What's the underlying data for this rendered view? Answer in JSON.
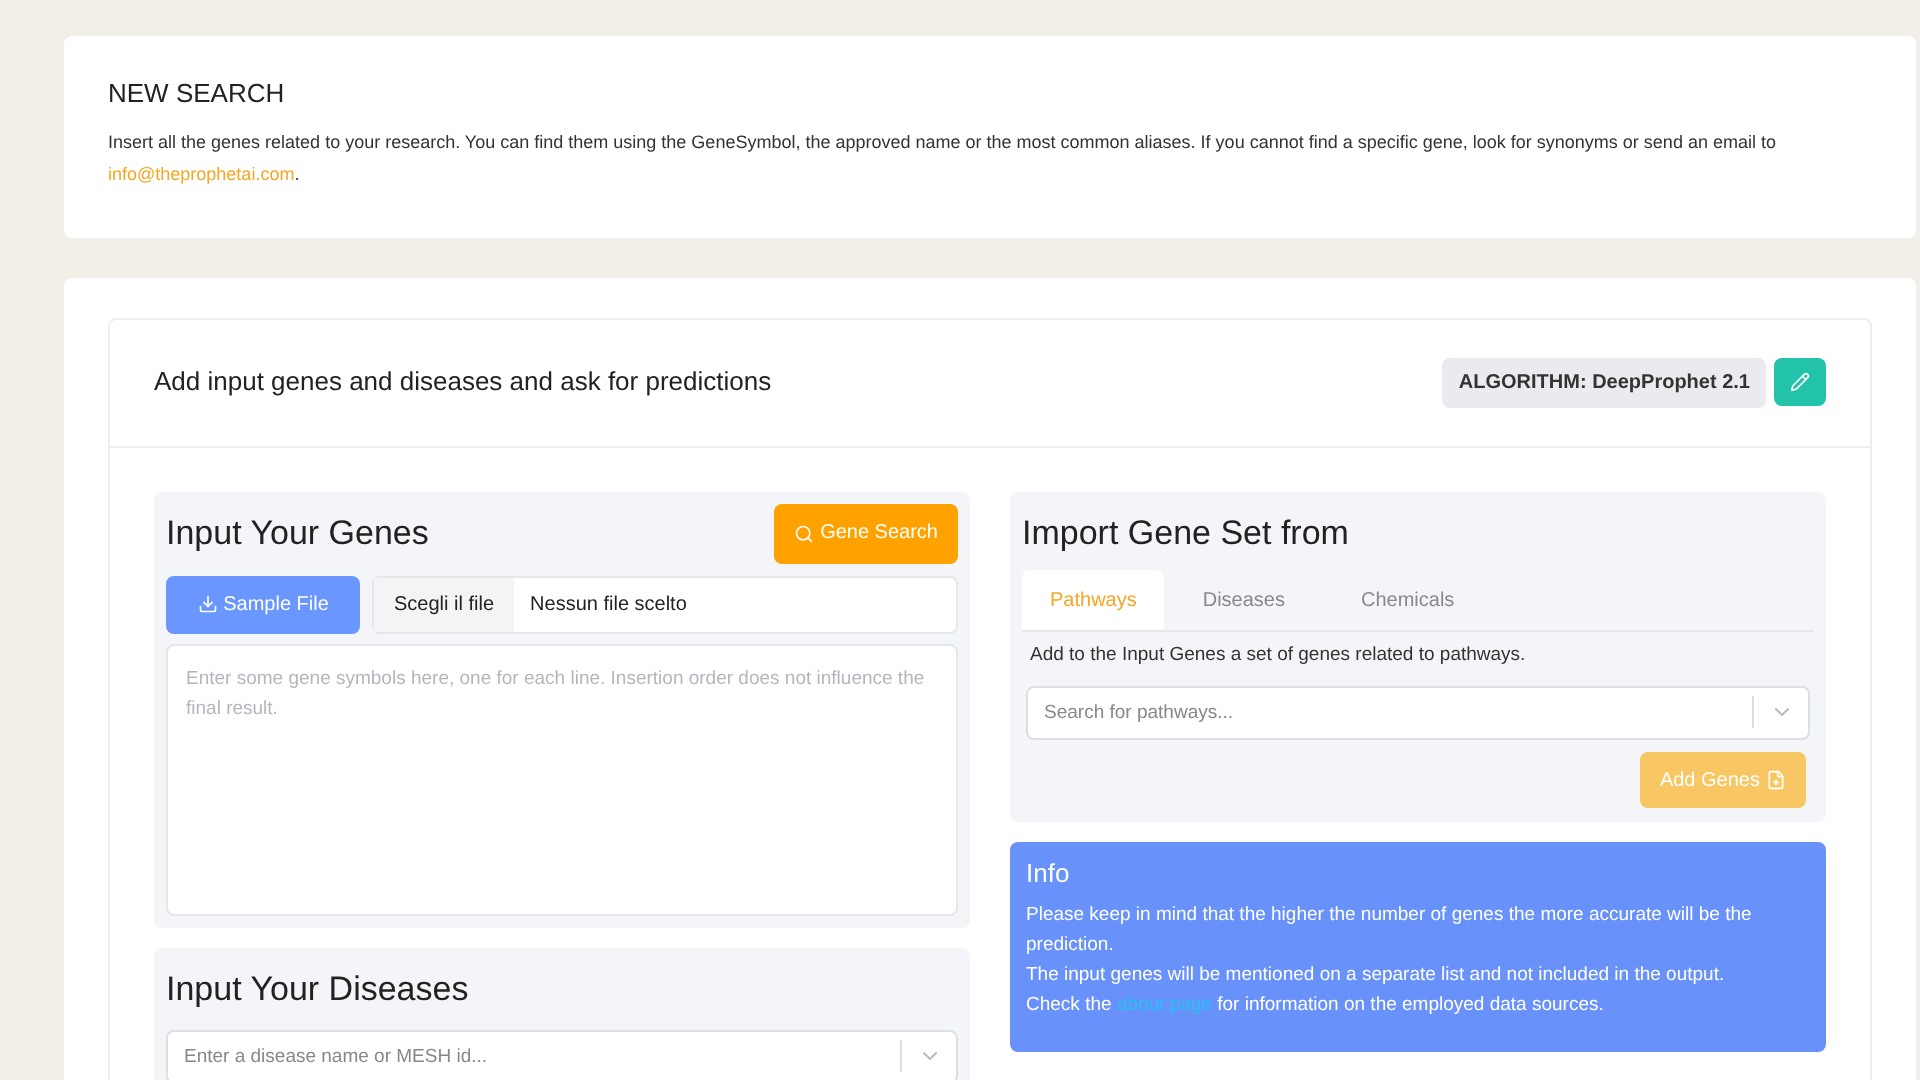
{
  "intro": {
    "title": "NEW SEARCH",
    "text_before": "Insert all the genes related to your research. You can find them using the GeneSymbol, the approved name or the most common aliases. If you cannot find a specific gene, look for synonyms or send an email to ",
    "email": "info@theprophetai.com",
    "text_after": "."
  },
  "card": {
    "title": "Add input genes and diseases and ask for predictions",
    "algorithm": "ALGORITHM: DeepProphet 2.1"
  },
  "genes": {
    "title": "Input Your Genes",
    "search_button": "Gene Search",
    "sample_button": "Sample File",
    "file_button": "Scegli il file",
    "file_status": "Nessun file scelto",
    "placeholder": "Enter some gene symbols here, one for each line. Insertion order does not influence the final result."
  },
  "diseases": {
    "title": "Input Your Diseases",
    "placeholder": "Enter a disease name or MESH id..."
  },
  "import": {
    "title": "Import Gene Set from",
    "tabs": [
      {
        "label": "Pathways",
        "selected": true
      },
      {
        "label": "Diseases",
        "selected": false
      },
      {
        "label": "Chemicals",
        "selected": false
      }
    ],
    "description": "Add to the Input Genes a set of genes related to pathways.",
    "placeholder": "Search for pathways...",
    "add_button": "Add Genes",
    "add_disabled": true
  },
  "info": {
    "title": "Info",
    "line1": "Please keep in mind that the higher the number of genes the more accurate will be the prediction.",
    "line2": "The input genes will be mentioned on a separate list and not included in the output.",
    "line3_before": "Check the ",
    "link": "about page",
    "line3_after": " for information on the employed data sources."
  }
}
